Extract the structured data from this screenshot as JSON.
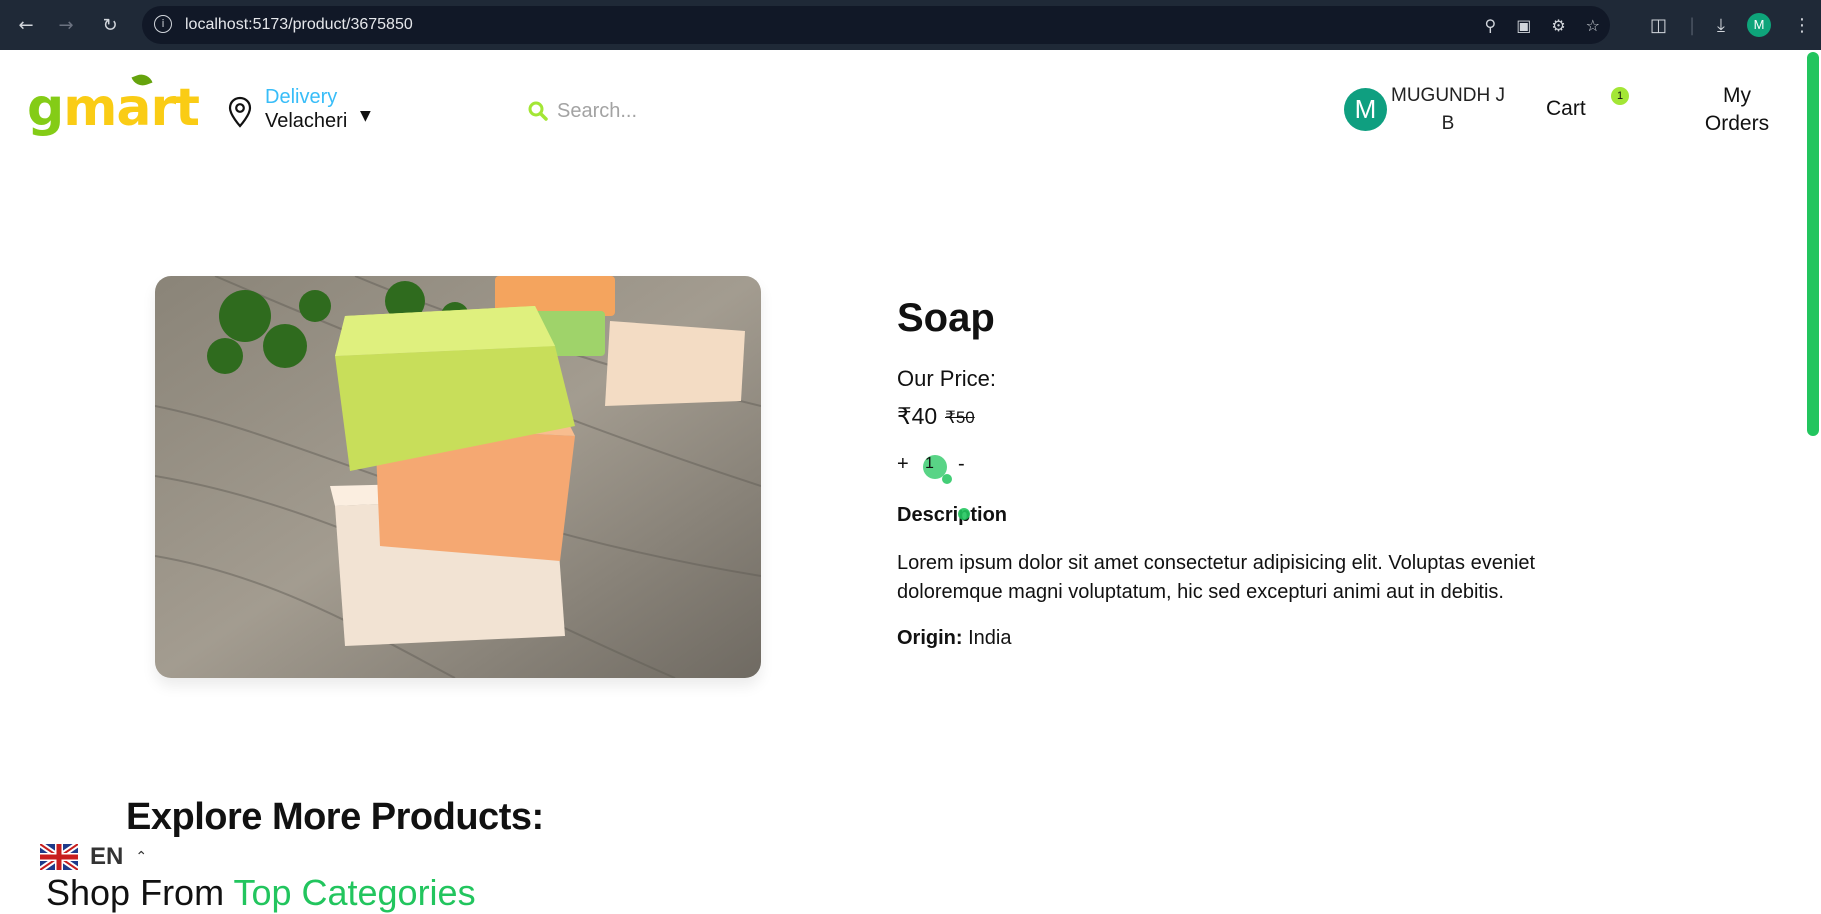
{
  "browser": {
    "url": "localhost:5173/product/3675850",
    "profile_initial": "M"
  },
  "header": {
    "logo_g": "g",
    "logo_mart": "mart",
    "delivery_label": "Delivery",
    "delivery_area": "Velacheri",
    "search_placeholder": "Search...",
    "user_initial": "M",
    "user_name": "MUGUNDH J B",
    "cart_label": "Cart",
    "cart_count": "1",
    "orders_label": "My Orders"
  },
  "product": {
    "title": "Soap",
    "price_label": "Our Price:",
    "price_current": "₹40",
    "price_old": "₹50",
    "qty_plus": "+",
    "qty_value": "1",
    "qty_minus": "-",
    "description_heading": "Description",
    "description": "Lorem ipsum dolor sit amet consectetur adipisicing elit. Voluptas eveniet doloremque magni voluptatum, hic sed excepturi animi aut in debitis.",
    "origin_label": "Origin:",
    "origin_value": "India"
  },
  "sections": {
    "explore_heading": "Explore More Products:",
    "shop_from": "Shop From",
    "shop_accent": "Top Categories"
  },
  "language": {
    "code": "EN"
  },
  "colors": {
    "brand_green": "#84cc16",
    "brand_yellow": "#facc15",
    "accent_green": "#22c55e",
    "avatar_teal": "#0f9f80",
    "delivery_blue": "#38bdf8"
  }
}
